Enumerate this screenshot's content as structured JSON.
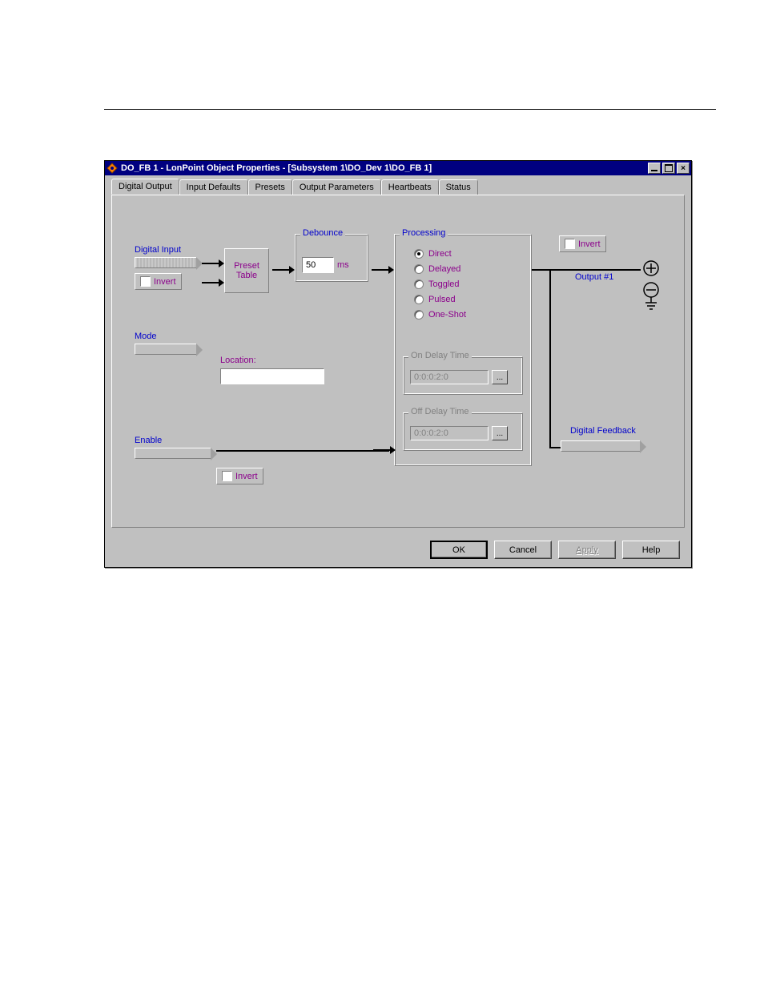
{
  "window": {
    "title": "DO_FB 1 - LonPoint Object Properties - [Subsystem 1\\DO_Dev 1\\DO_FB 1]"
  },
  "tabs": [
    "Digital Output",
    "Input Defaults",
    "Presets",
    "Output Parameters",
    "Heartbeats",
    "Status"
  ],
  "active_tab": 0,
  "digital_input": {
    "label": "Digital Input",
    "invert_label": "Invert",
    "invert_checked": false
  },
  "mode": {
    "label": "Mode"
  },
  "enable": {
    "label": "Enable",
    "invert_label": "Invert",
    "invert_checked": false
  },
  "preset_table": {
    "label1": "Preset",
    "label2": "Table"
  },
  "debounce": {
    "legend": "Debounce",
    "value": "50",
    "unit": "ms"
  },
  "location": {
    "label": "Location:",
    "value": ""
  },
  "processing": {
    "legend": "Processing",
    "options": [
      "Direct",
      "Delayed",
      "Toggled",
      "Pulsed",
      "One-Shot"
    ],
    "selected": 0,
    "on_delay": {
      "legend": "On Delay Time",
      "value": "0:0:0:2:0"
    },
    "off_delay": {
      "legend": "Off Delay Time",
      "value": "0:0:0:2:0"
    }
  },
  "output": {
    "invert_label": "Invert",
    "invert_checked": false,
    "label": "Output #1",
    "feedback_label": "Digital Feedback"
  },
  "buttons": {
    "ok": "OK",
    "cancel": "Cancel",
    "apply": "Apply",
    "help": "Help"
  }
}
